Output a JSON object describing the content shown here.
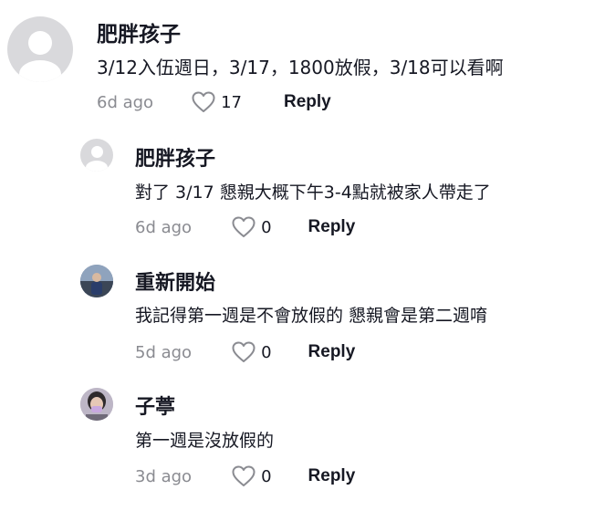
{
  "comments": [
    {
      "username": "肥胖孩子",
      "text": "3/12入伍週日，3/17，1800放假，3/18可以看啊",
      "time": "6d ago",
      "likes": "17",
      "reply_label": "Reply",
      "avatar": "default-avatar-icon"
    },
    {
      "username": "肥胖孩子",
      "text": "對了 3/17 懇親大概下午3-4點就被家人帶走了",
      "time": "6d ago",
      "likes": "0",
      "reply_label": "Reply",
      "avatar": "default-avatar-icon"
    },
    {
      "username": "重新開始",
      "text": "我記得第一週是不會放假的 懇親會是第二週唷",
      "time": "5d ago",
      "likes": "0",
      "reply_label": "Reply",
      "avatar": "photo-avatar"
    },
    {
      "username": "子葶",
      "text": "第一週是沒放假的",
      "time": "3d ago",
      "likes": "0",
      "reply_label": "Reply",
      "avatar": "photo-avatar"
    }
  ],
  "colors": {
    "text": "#161823",
    "secondary": "#8a8b91",
    "avatar_bg": "#d9d9dc"
  }
}
